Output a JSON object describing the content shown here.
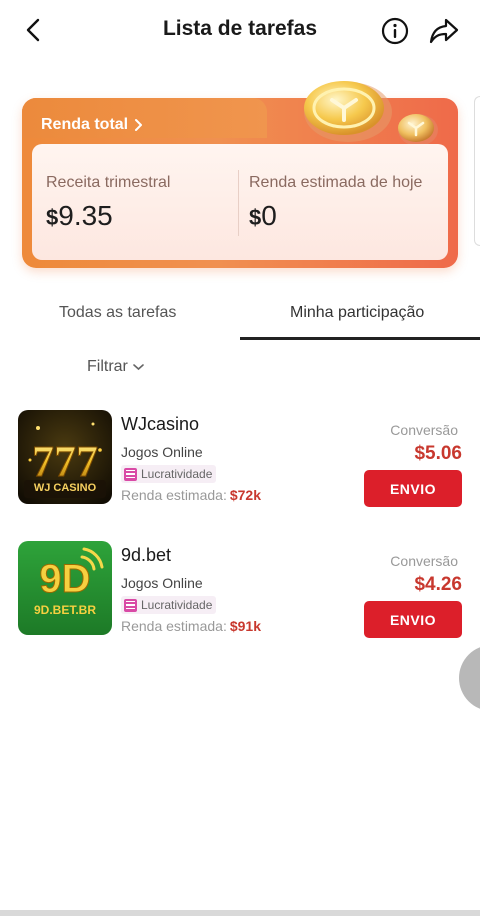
{
  "header": {
    "title": "Lista de tarefas"
  },
  "summary": {
    "title": "Renda total",
    "quarterly_label": "Receita trimestral",
    "quarterly_currency": "$",
    "quarterly_value": "9.35",
    "today_label": "Renda estimada de hoje",
    "today_currency": "$",
    "today_value": "0"
  },
  "tabs": [
    {
      "label": "Todas as tarefas",
      "active": false
    },
    {
      "label": "Minha participação",
      "active": true
    }
  ],
  "filter": {
    "label": "Filtrar"
  },
  "tasks": [
    {
      "name": "WJcasino",
      "category": "Jogos Online",
      "tag": "Lucratividade",
      "income_label": "Renda estimada:",
      "income_value": "$72k",
      "conversion_label": "Conversão",
      "conversion_value": "$5.06",
      "button_label": "ENVIO",
      "logo_text": "WJ CASINO",
      "logo_sub": "777"
    },
    {
      "name": "9d.bet",
      "category": "Jogos Online",
      "tag": "Lucratividade",
      "income_label": "Renda estimada:",
      "income_value": "$91k",
      "conversion_label": "Conversão",
      "conversion_value": "$4.26",
      "button_label": "ENVIO",
      "logo_text": "9D",
      "logo_sub": "9D.BET.BR"
    }
  ],
  "colors": {
    "accent": "#dc1f2a",
    "price": "#c8382e",
    "card_orange": "#ef8c44"
  }
}
